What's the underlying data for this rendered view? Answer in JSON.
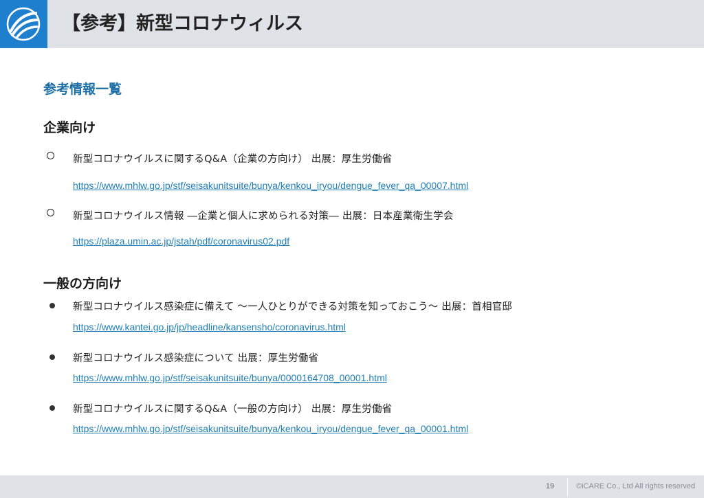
{
  "header": {
    "title": "【参考】新型コロナウィルス",
    "logo": "company-logo"
  },
  "section": {
    "heading": "参考情報一覧"
  },
  "corporate": {
    "heading": "企業向け",
    "items": [
      {
        "bullet": "hollow-circle",
        "text": "新型コロナウイルスに関するQ&A（企業の方向け） 出展：厚生労働省",
        "link": "https://www.mhlw.go.jp/stf/seisakunitsuite/bunya/kenkou_iryou/dengue_fever_qa_00007.html"
      },
      {
        "bullet": "hollow-circle",
        "text": "新型コロナウイルス情報 ―企業と個人に求められる対策― 出展：日本産業衛生学会",
        "link": "https://plaza.umin.ac.jp/jstah/pdf/coronavirus02.pdf"
      }
    ]
  },
  "general": {
    "heading": "一般の方向け",
    "items": [
      {
        "bullet": "filled-circle",
        "text": "新型コロナウイルス感染症に備えて ～一人ひとりができる対策を知っておこう～ 出展：首相官邸",
        "link": "https://www.kantei.go.jp/jp/headline/kansensho/coronavirus.html"
      },
      {
        "bullet": "filled-circle",
        "text": "新型コロナウイルス感染症について 出展：厚生労働省",
        "link": "https://www.mhlw.go.jp/stf/seisakunitsuite/bunya/0000164708_00001.html"
      },
      {
        "bullet": "filled-circle",
        "text": "新型コロナウイルスに関するQ&A（一般の方向け） 出展：厚生労働省",
        "link": "https://www.mhlw.go.jp/stf/seisakunitsuite/bunya/kenkou_iryou/dengue_fever_qa_00001.html"
      }
    ]
  },
  "footer": {
    "page_number": "19",
    "copyright": "©iCARE Co., Ltd All rights reserved"
  },
  "colors": {
    "brand_blue": "#1f7fcf",
    "heading_blue": "#1b6ea5",
    "link_blue": "#1f7fb5",
    "bar_gray": "#dfe2e6"
  }
}
